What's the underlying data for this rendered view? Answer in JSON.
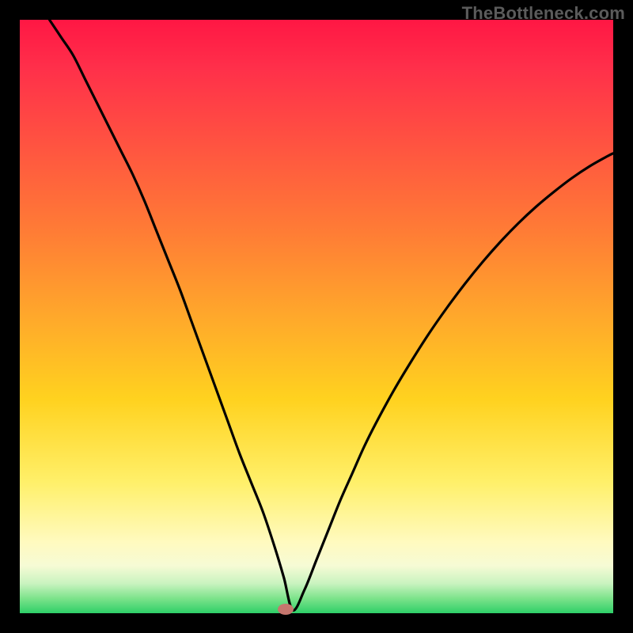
{
  "watermark": "TheBottleneck.com",
  "chart_data": {
    "type": "line",
    "title": "",
    "xlabel": "",
    "ylabel": "",
    "xlim": [
      0,
      100
    ],
    "ylim": [
      0,
      100
    ],
    "grid": false,
    "legend": false,
    "series": [
      {
        "name": "curve",
        "x": [
          5,
          7,
          9,
          11,
          13,
          15,
          17,
          19,
          21,
          23,
          25,
          27,
          29,
          31,
          33,
          35,
          37,
          39,
          41,
          43,
          44.5,
          46,
          48,
          50,
          52,
          54,
          56,
          58,
          60,
          63,
          66,
          69,
          72,
          75,
          78,
          81,
          84,
          87,
          90,
          93,
          96,
          99,
          100
        ],
        "y": [
          100,
          97,
          94,
          90,
          86,
          82,
          78,
          74,
          69.5,
          64.5,
          59.5,
          54.5,
          49,
          43.5,
          38,
          32.5,
          27,
          22,
          17,
          11,
          6,
          0.5,
          4,
          9,
          14,
          19,
          23.5,
          28,
          32,
          37.5,
          42.5,
          47.2,
          51.5,
          55.5,
          59.2,
          62.6,
          65.7,
          68.5,
          71,
          73.3,
          75.3,
          77,
          77.5
        ]
      }
    ],
    "marker": {
      "x": 44.8,
      "y": 0.7
    }
  },
  "colors": {
    "gradient_top": "#ff1744",
    "gradient_mid": "#ffd21f",
    "gradient_bottom": "#2ecf68",
    "curve": "#000000",
    "marker": "#c6766e",
    "frame": "#000000"
  }
}
